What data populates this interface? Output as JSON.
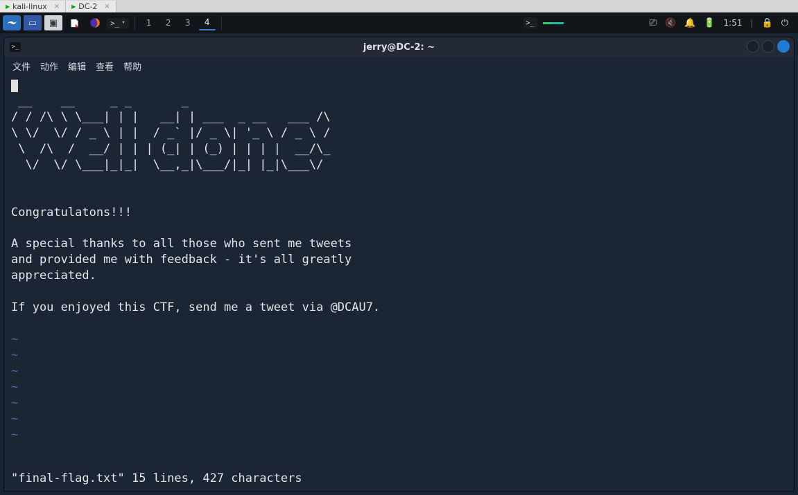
{
  "browserTabs": [
    {
      "label": "kali-linux"
    },
    {
      "label": "DC-2"
    }
  ],
  "taskbar": {
    "workspaces": [
      "1",
      "2",
      "3",
      "4"
    ],
    "activeWorkspace": "4",
    "clock": "1:51"
  },
  "terminal": {
    "title": "jerry@DC-2: ~",
    "menu": [
      "文件",
      "动作",
      "编辑",
      "查看",
      "帮助"
    ],
    "ascii": " __    __     _ _       _\n/ / /\\ \\ \\___| | |   __| | ___  _ __   ___ /\\\n\\ \\/  \\/ / _ \\ | |  / _` |/ _ \\| '_ \\ / _ \\ /\n \\  /\\  /  __/ | | | (_| | (_) | | | |  __/\\_\n  \\/  \\/ \\___|_|_|  \\__,_|\\___/|_| |_|\\___\\/",
    "body1": "Congratulatons!!!",
    "body2": "A special thanks to all those who sent me tweets",
    "body3": "and provided me with feedback - it's all greatly",
    "body4": "appreciated.",
    "body5": "If you enjoyed this CTF, send me a tweet via @DCAU7.",
    "tildeCount": 7,
    "status": "\"final-flag.txt\" 15 lines, 427 characters"
  }
}
